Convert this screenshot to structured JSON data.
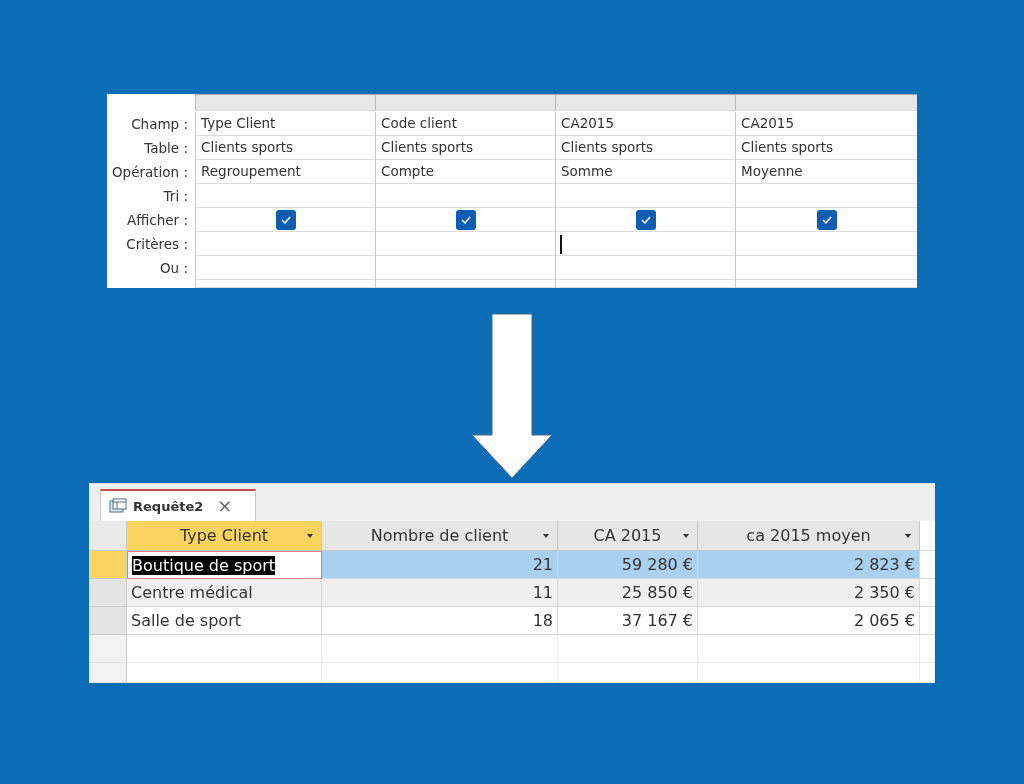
{
  "query_grid": {
    "row_labels": [
      "Champ :",
      "Table :",
      "Opération :",
      "Tri :",
      "Afficher :",
      "Critères :",
      "Ou :"
    ],
    "columns": [
      {
        "field": "Type Client",
        "table": "Clients sports",
        "operation": "Regroupement",
        "show": true,
        "caret": false
      },
      {
        "field": "Code client",
        "table": "Clients sports",
        "operation": "Compte",
        "show": true,
        "caret": false
      },
      {
        "field": "CA2015",
        "table": "Clients sports",
        "operation": "Somme",
        "show": true,
        "caret": true
      },
      {
        "field": "CA2015",
        "table": "Clients sports",
        "operation": "Moyenne",
        "show": true,
        "caret": false
      }
    ]
  },
  "result": {
    "tab": {
      "label": "Requête2",
      "close": "×"
    },
    "columns": [
      {
        "label": "Type Client",
        "selected": true
      },
      {
        "label": "Nombre de client",
        "selected": false
      },
      {
        "label": "CA 2015",
        "selected": false
      },
      {
        "label": "ca 2015 moyen",
        "selected": false
      }
    ],
    "rows": [
      {
        "selected": true,
        "editing": true,
        "cells": [
          "Boutique de sport",
          "21",
          "59 280 €",
          "2 823 €"
        ]
      },
      {
        "selected": false,
        "editing": false,
        "cells": [
          "Centre médical",
          "11",
          "25 850 €",
          "2 350 €"
        ]
      },
      {
        "selected": false,
        "editing": false,
        "cells": [
          "Salle de sport",
          "18",
          "37 167 €",
          "2 065 €"
        ]
      }
    ]
  }
}
